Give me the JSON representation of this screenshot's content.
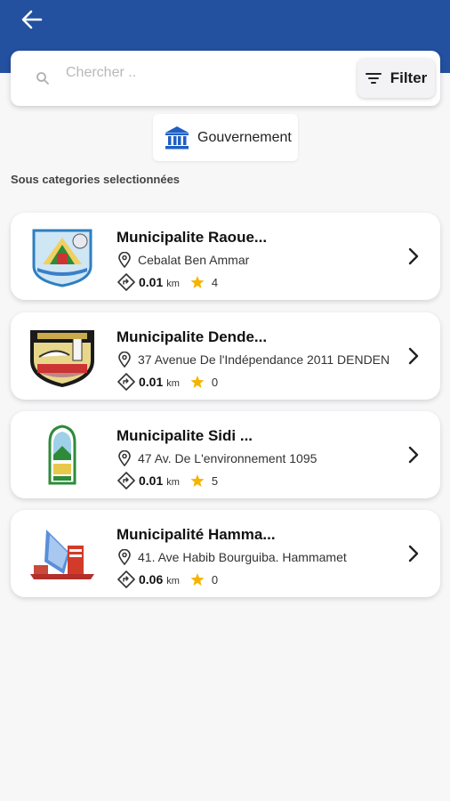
{
  "search": {
    "placeholder": "Chercher .."
  },
  "filter": {
    "label": "Filter"
  },
  "category_chip": {
    "label": "Gouvernement",
    "icon": "government-building-icon"
  },
  "section_title": "Sous categories selectionnées",
  "colors": {
    "appbar": "#23509f",
    "star": "#f5b400",
    "icon_blue": "#1f5fc4"
  },
  "items": [
    {
      "title": "Municipalite Raoue...",
      "address": "Cebalat Ben Ammar",
      "distance": "0.01",
      "unit": "km",
      "rating": "4"
    },
    {
      "title": "Municipalite Dende...",
      "address": "37 Avenue De l'Indépendance 2011 DENDEN",
      "distance": "0.01",
      "unit": "km",
      "rating": "0"
    },
    {
      "title": "Municipalite Sidi ...",
      "address": "47 Av. De L'environnement 1095",
      "distance": "0.01",
      "unit": "km",
      "rating": "5"
    },
    {
      "title": "Municipalité Hamma...",
      "address": "41. Ave Habib Bourguiba. Hammamet",
      "distance": "0.06",
      "unit": "km",
      "rating": "0"
    }
  ]
}
